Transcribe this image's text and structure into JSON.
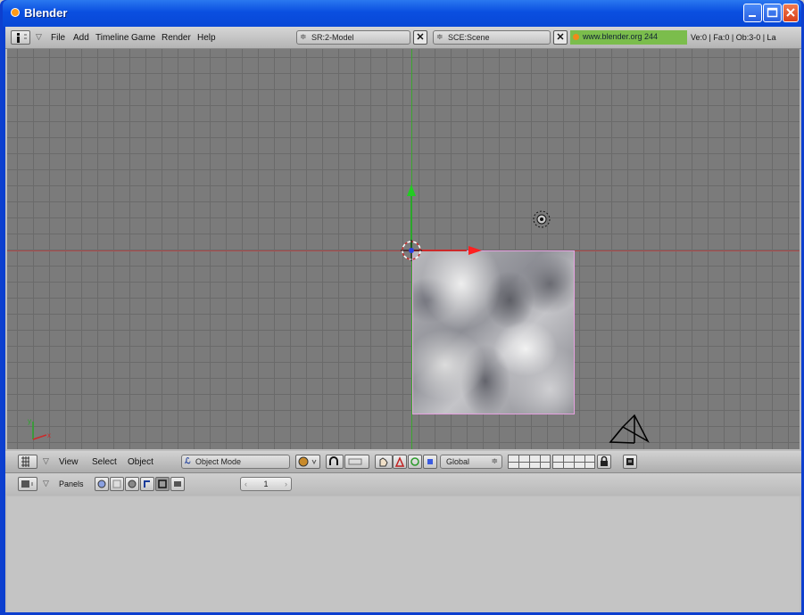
{
  "window": {
    "title": "Blender"
  },
  "top_header": {
    "menus": [
      "File",
      "Add",
      "Timeline",
      "Game",
      "Render",
      "Help"
    ],
    "screen_field": "SR:2-Model",
    "scene_field": "SCE:Scene",
    "url": "www.blender.org 244",
    "stats": "Ve:0 | Fa:0 | Ob:3-0 | La"
  },
  "view_header": {
    "menus": [
      "View",
      "Select",
      "Object"
    ],
    "mode": "Object Mode",
    "orientation": "Global"
  },
  "buttons_header": {
    "panels_label": "Panels",
    "frame_value": "1",
    "frame_left": "‹",
    "frame_right": "›"
  },
  "colors": {
    "titlebar": "#0a4fe0",
    "viewport_bg": "#7b7b7b",
    "x_axis": "#b04a4a",
    "y_axis": "#3aa52e",
    "selection_outline": "#e6a0e0",
    "url_bg": "#7bbd4c"
  },
  "icons": [
    "blender-logo-icon",
    "minimize-icon",
    "maximize-icon",
    "close-icon",
    "info-window-icon",
    "3d-view-icon",
    "buttons-window-icon",
    "lamp-icon",
    "camera-icon",
    "3d-cursor-icon"
  ]
}
